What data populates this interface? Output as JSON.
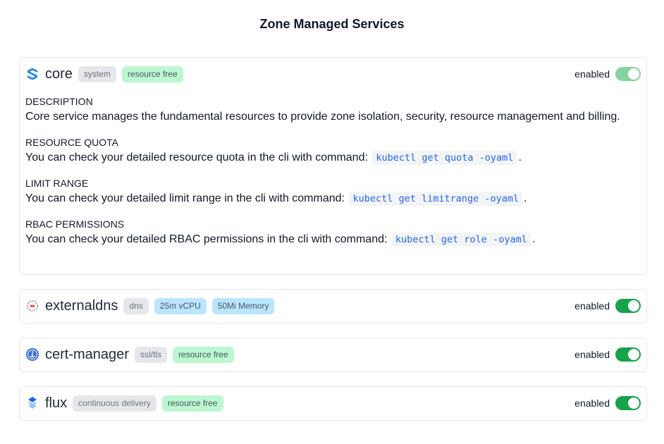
{
  "title": "Zone Managed Services",
  "services": [
    {
      "name": "core",
      "icon": "core-logo-icon",
      "badges": [
        {
          "label": "system",
          "style": "gray"
        },
        {
          "label": "resource free",
          "style": "green"
        }
      ],
      "toggle_label": "enabled",
      "enabled": true,
      "toggle_disabled": true,
      "sections": [
        {
          "title": "DESCRIPTION",
          "text": "Core service manages the fundamental resources to provide zone isolation, security, resource management and billing.",
          "command": "",
          "suffix": ""
        },
        {
          "title": "RESOURCE QUOTA",
          "text": "You can check your detailed resource quota in the cli with command:",
          "command": "kubectl get quota -oyaml",
          "suffix": "."
        },
        {
          "title": "LIMIT RANGE",
          "text": "You can check your detailed limit range in the cli with command:",
          "command": "kubectl get limitrange -oyaml",
          "suffix": "."
        },
        {
          "title": "RBAC PERMISSIONS",
          "text": "You can check your detailed RBAC permissions in the cli with command:",
          "command": "kubectl get role -oyaml",
          "suffix": "."
        }
      ]
    },
    {
      "name": "externaldns",
      "icon": "externaldns-logo-icon",
      "badges": [
        {
          "label": "dns",
          "style": "gray"
        },
        {
          "label": "25m vCPU",
          "style": "blue"
        },
        {
          "label": "50Mi Memory",
          "style": "blue"
        }
      ],
      "toggle_label": "enabled",
      "enabled": true
    },
    {
      "name": "cert-manager",
      "icon": "cert-manager-logo-icon",
      "badges": [
        {
          "label": "ssl/tls",
          "style": "gray"
        },
        {
          "label": "resource free",
          "style": "green"
        }
      ],
      "toggle_label": "enabled",
      "enabled": true
    },
    {
      "name": "flux",
      "icon": "flux-logo-icon",
      "badges": [
        {
          "label": "continuous delivery",
          "style": "gray"
        },
        {
          "label": "resource free",
          "style": "green"
        }
      ],
      "toggle_label": "enabled",
      "enabled": true
    }
  ]
}
